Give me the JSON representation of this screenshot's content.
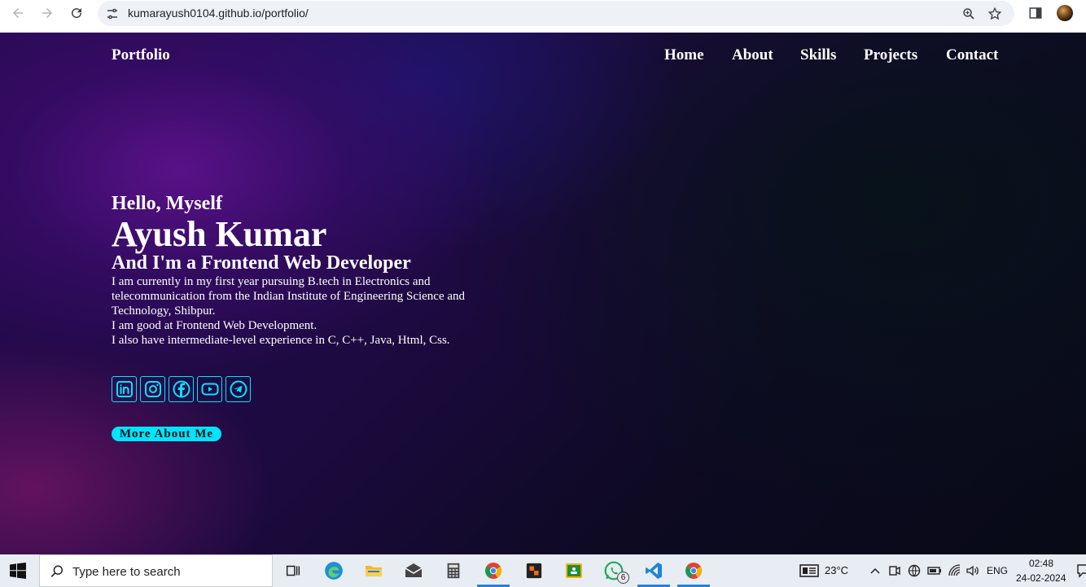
{
  "browser": {
    "url": "kumarayush0104.github.io/portfolio/"
  },
  "site": {
    "logo": "Portfolio",
    "nav": [
      "Home",
      "About",
      "Skills",
      "Projects",
      "Contact"
    ],
    "greeting": "Hello, Myself",
    "name": "Ayush Kumar",
    "role": "And I'm a Frontend Web Developer",
    "bio": [
      "I am currently in my first year pursuing B.tech in Electronics and telecommunication from the Indian Institute of Engineering Science and Technology, Shibpur.",
      "I am good at Frontend Web Development.",
      "I also have intermediate-level experience in C, C++, Java, Html, Css."
    ],
    "socials": [
      "linkedin-icon",
      "instagram-icon",
      "facebook-icon",
      "youtube-icon",
      "telegram-icon"
    ],
    "cta": "More About Me",
    "accent_color": "#00e5ff"
  },
  "taskbar": {
    "search_placeholder": "Type here to search",
    "whatsapp_badge": "6",
    "weather": "23°C",
    "language": "ENG",
    "time": "02:48",
    "date": "24-02-2024"
  }
}
